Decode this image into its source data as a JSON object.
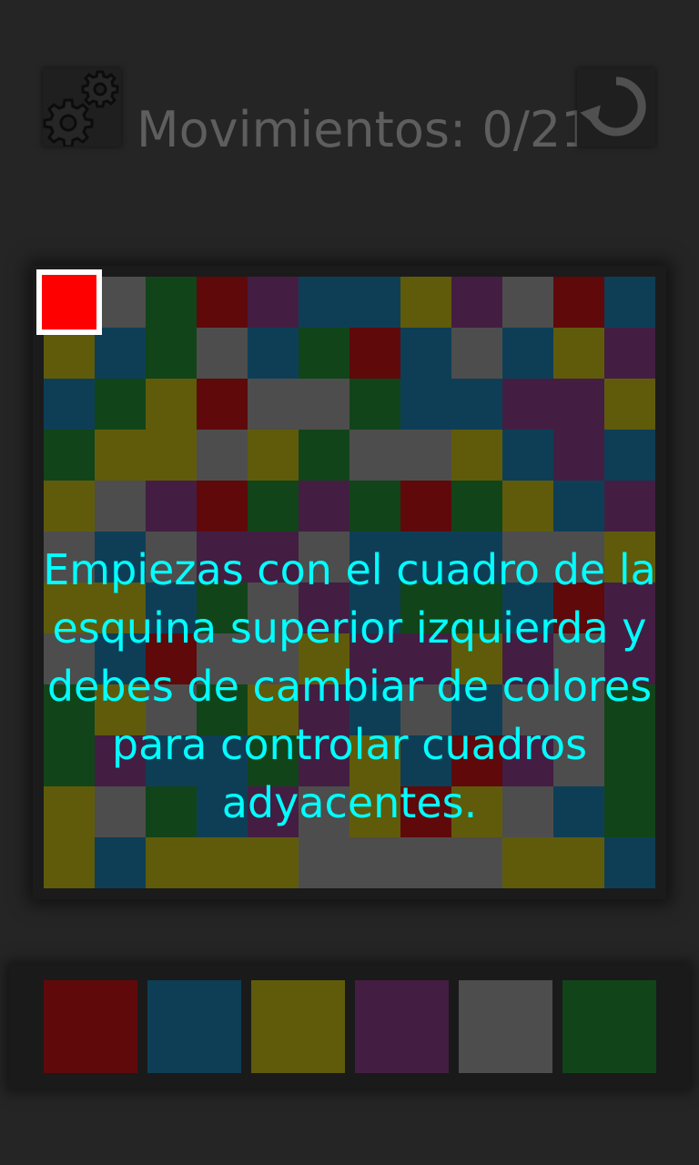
{
  "header": {
    "moves_label": "Movimientos: 0/21",
    "settings_icon": "gears-icon",
    "restart_icon": "restart-icon"
  },
  "colors": {
    "r": "#5f090b",
    "b": "#0e3e56",
    "y": "#5f5b0b",
    "p": "#431e42",
    "g": "#4d4d4d",
    "n": "#124419",
    "current": "#ff0000",
    "text": "#00ffff"
  },
  "board": {
    "rows": [
      "rgnrpbbypgrb",
      "ybngbnrbgbyp",
      "bnyrggnbbppy",
      "nyygynggybpb",
      "ygprnpnrnybp",
      "gbgppgbbbggy",
      "yybngpbnnbrp",
      "gbrggyppypgp",
      "nygnypbgbggn",
      "npbbnpybrpgn",
      "ygnbpgyrygbn",
      "ybyyyggggyyb"
    ]
  },
  "tutorial": {
    "lines": [
      "Empiezas con el cuadro de la",
      "esquina superior izquierda y",
      "debes de cambiar de colores",
      "para controlar cuadros",
      "adyacentes."
    ]
  },
  "palette": [
    "r",
    "b",
    "y",
    "p",
    "g",
    "n"
  ]
}
